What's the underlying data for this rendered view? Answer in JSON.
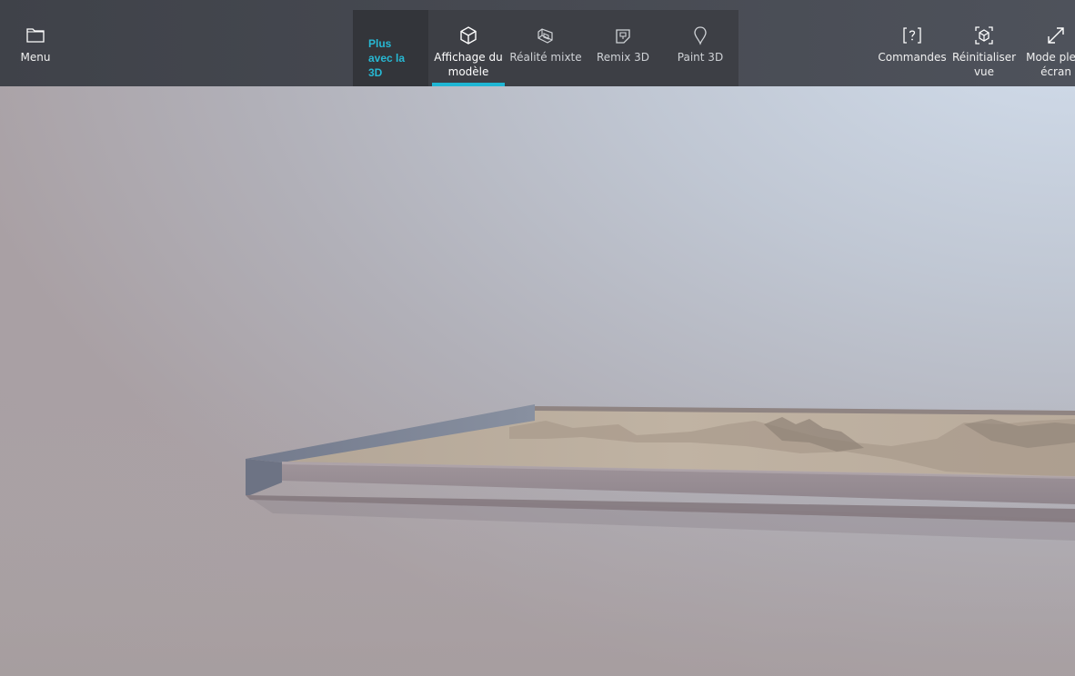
{
  "toolbar": {
    "menu_label": "Menu",
    "plus_3d_label": "Plus avec la 3D",
    "tabs": [
      {
        "label": "Affichage du modèle",
        "icon": "cube-icon",
        "active": true
      },
      {
        "label": "Réalité mixte",
        "icon": "mixed-reality-icon",
        "active": false
      },
      {
        "label": "Remix 3D",
        "icon": "remix-3d-icon",
        "active": false
      },
      {
        "label": "Paint 3D",
        "icon": "paint-3d-icon",
        "active": false
      }
    ],
    "commands_label": "Commandes",
    "reset_view_label": "Réinitialiser vue",
    "fullscreen_label": "Mode plein écran"
  },
  "colors": {
    "accent": "#1fb6d4",
    "toolbar_bg": "#474a52",
    "plus_3d_text": "#27b8d3"
  },
  "icons": {
    "menu": "folder-icon",
    "commands": "question-bracket-icon",
    "reset_view": "reset-view-cube-icon",
    "fullscreen": "expand-diagonal-icon"
  }
}
